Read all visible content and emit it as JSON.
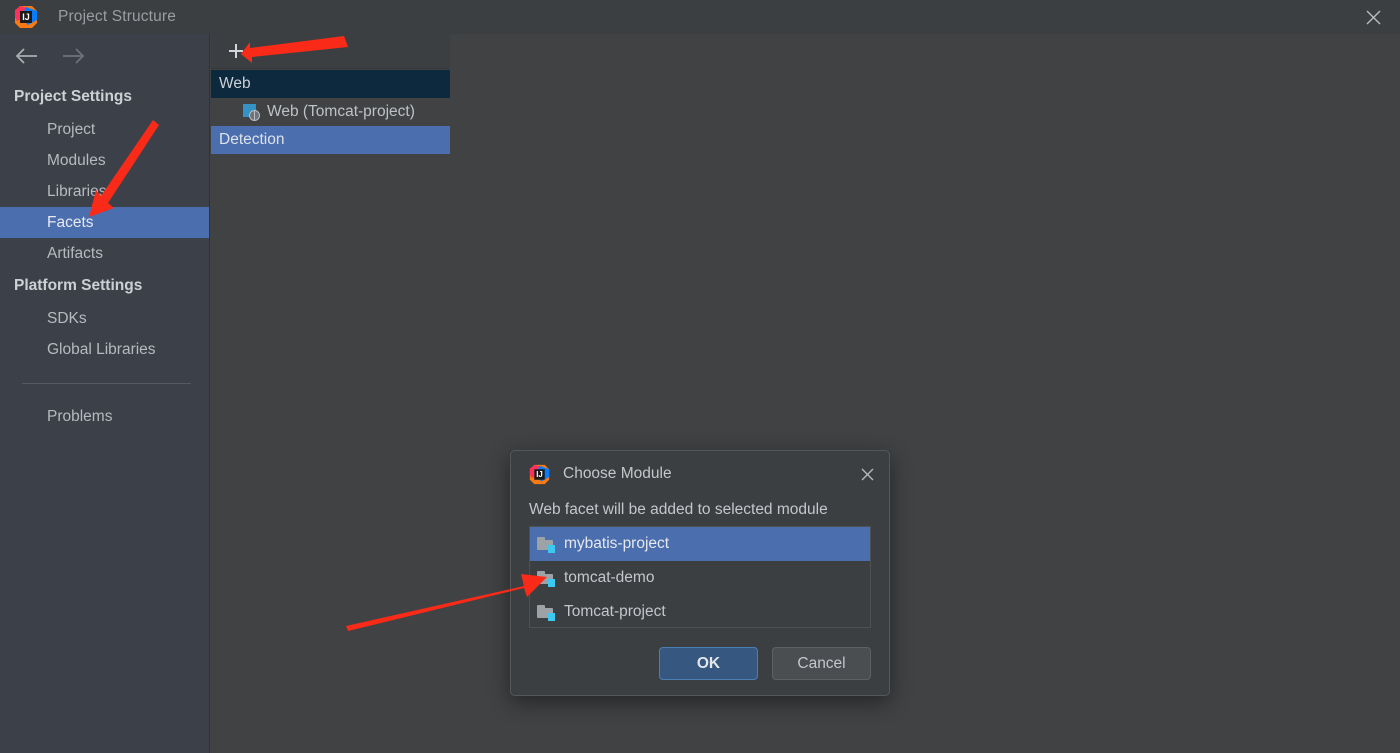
{
  "window": {
    "title": "Project Structure",
    "logo_icon": "intellij-idea-logo",
    "close_icon": "close-icon"
  },
  "sidebar": {
    "nav": {
      "back_icon": "arrow-left-icon",
      "forward_icon": "arrow-right-icon"
    },
    "groups": [
      {
        "label": "Project Settings",
        "items": [
          {
            "label": "Project",
            "selected": false
          },
          {
            "label": "Modules",
            "selected": false
          },
          {
            "label": "Libraries",
            "selected": false
          },
          {
            "label": "Facets",
            "selected": true
          },
          {
            "label": "Artifacts",
            "selected": false
          }
        ]
      },
      {
        "label": "Platform Settings",
        "items": [
          {
            "label": "SDKs",
            "selected": false
          },
          {
            "label": "Global Libraries",
            "selected": false
          }
        ]
      }
    ],
    "problems_label": "Problems"
  },
  "facets_panel": {
    "toolbar": {
      "add_label": "+",
      "add_icon": "plus-icon",
      "remove_label": "−",
      "remove_icon": "minus-icon"
    },
    "tree": [
      {
        "label": "Web",
        "type": "group",
        "indent": 0,
        "selection": "inactive",
        "icon": null
      },
      {
        "label": "Web (Tomcat-project)",
        "type": "facet",
        "indent": 1,
        "selection": "none",
        "icon": "web-facet-icon"
      },
      {
        "label": "Detection",
        "type": "group",
        "indent": 0,
        "selection": "active",
        "icon": null
      }
    ]
  },
  "dialog": {
    "logo_icon": "intellij-idea-logo",
    "title": "Choose Module",
    "close_icon": "close-icon",
    "message": "Web facet will be added to selected module",
    "modules": [
      {
        "label": "mybatis-project",
        "icon": "module-icon",
        "selected": true
      },
      {
        "label": "tomcat-demo",
        "icon": "module-icon",
        "selected": false
      },
      {
        "label": "Tomcat-project",
        "icon": "module-icon",
        "selected": false
      }
    ],
    "buttons": {
      "ok_label": "OK",
      "cancel_label": "Cancel"
    }
  },
  "annotations": {
    "color": "#FA2A19",
    "arrows": [
      {
        "name": "arrow-to-add-button",
        "points": "from (340,40) to (243,55)"
      },
      {
        "name": "arrow-to-facets-item",
        "points": "from (157,127) to (90,216)"
      },
      {
        "name": "arrow-to-tomcat-demo",
        "points": "from (347,625) to (540,577)"
      }
    ]
  },
  "colors": {
    "window_bg": "#404244",
    "titlebar_bg": "#3C3F41",
    "sidebar_bg": "#3C4048",
    "dialog_bg": "#3C3F41",
    "selection_active": "#4B6EAF",
    "selection_inactive": "#0D293E",
    "primary_button": "#365880",
    "annotation_red": "#FA2A19",
    "text": "#c3c7cb"
  }
}
